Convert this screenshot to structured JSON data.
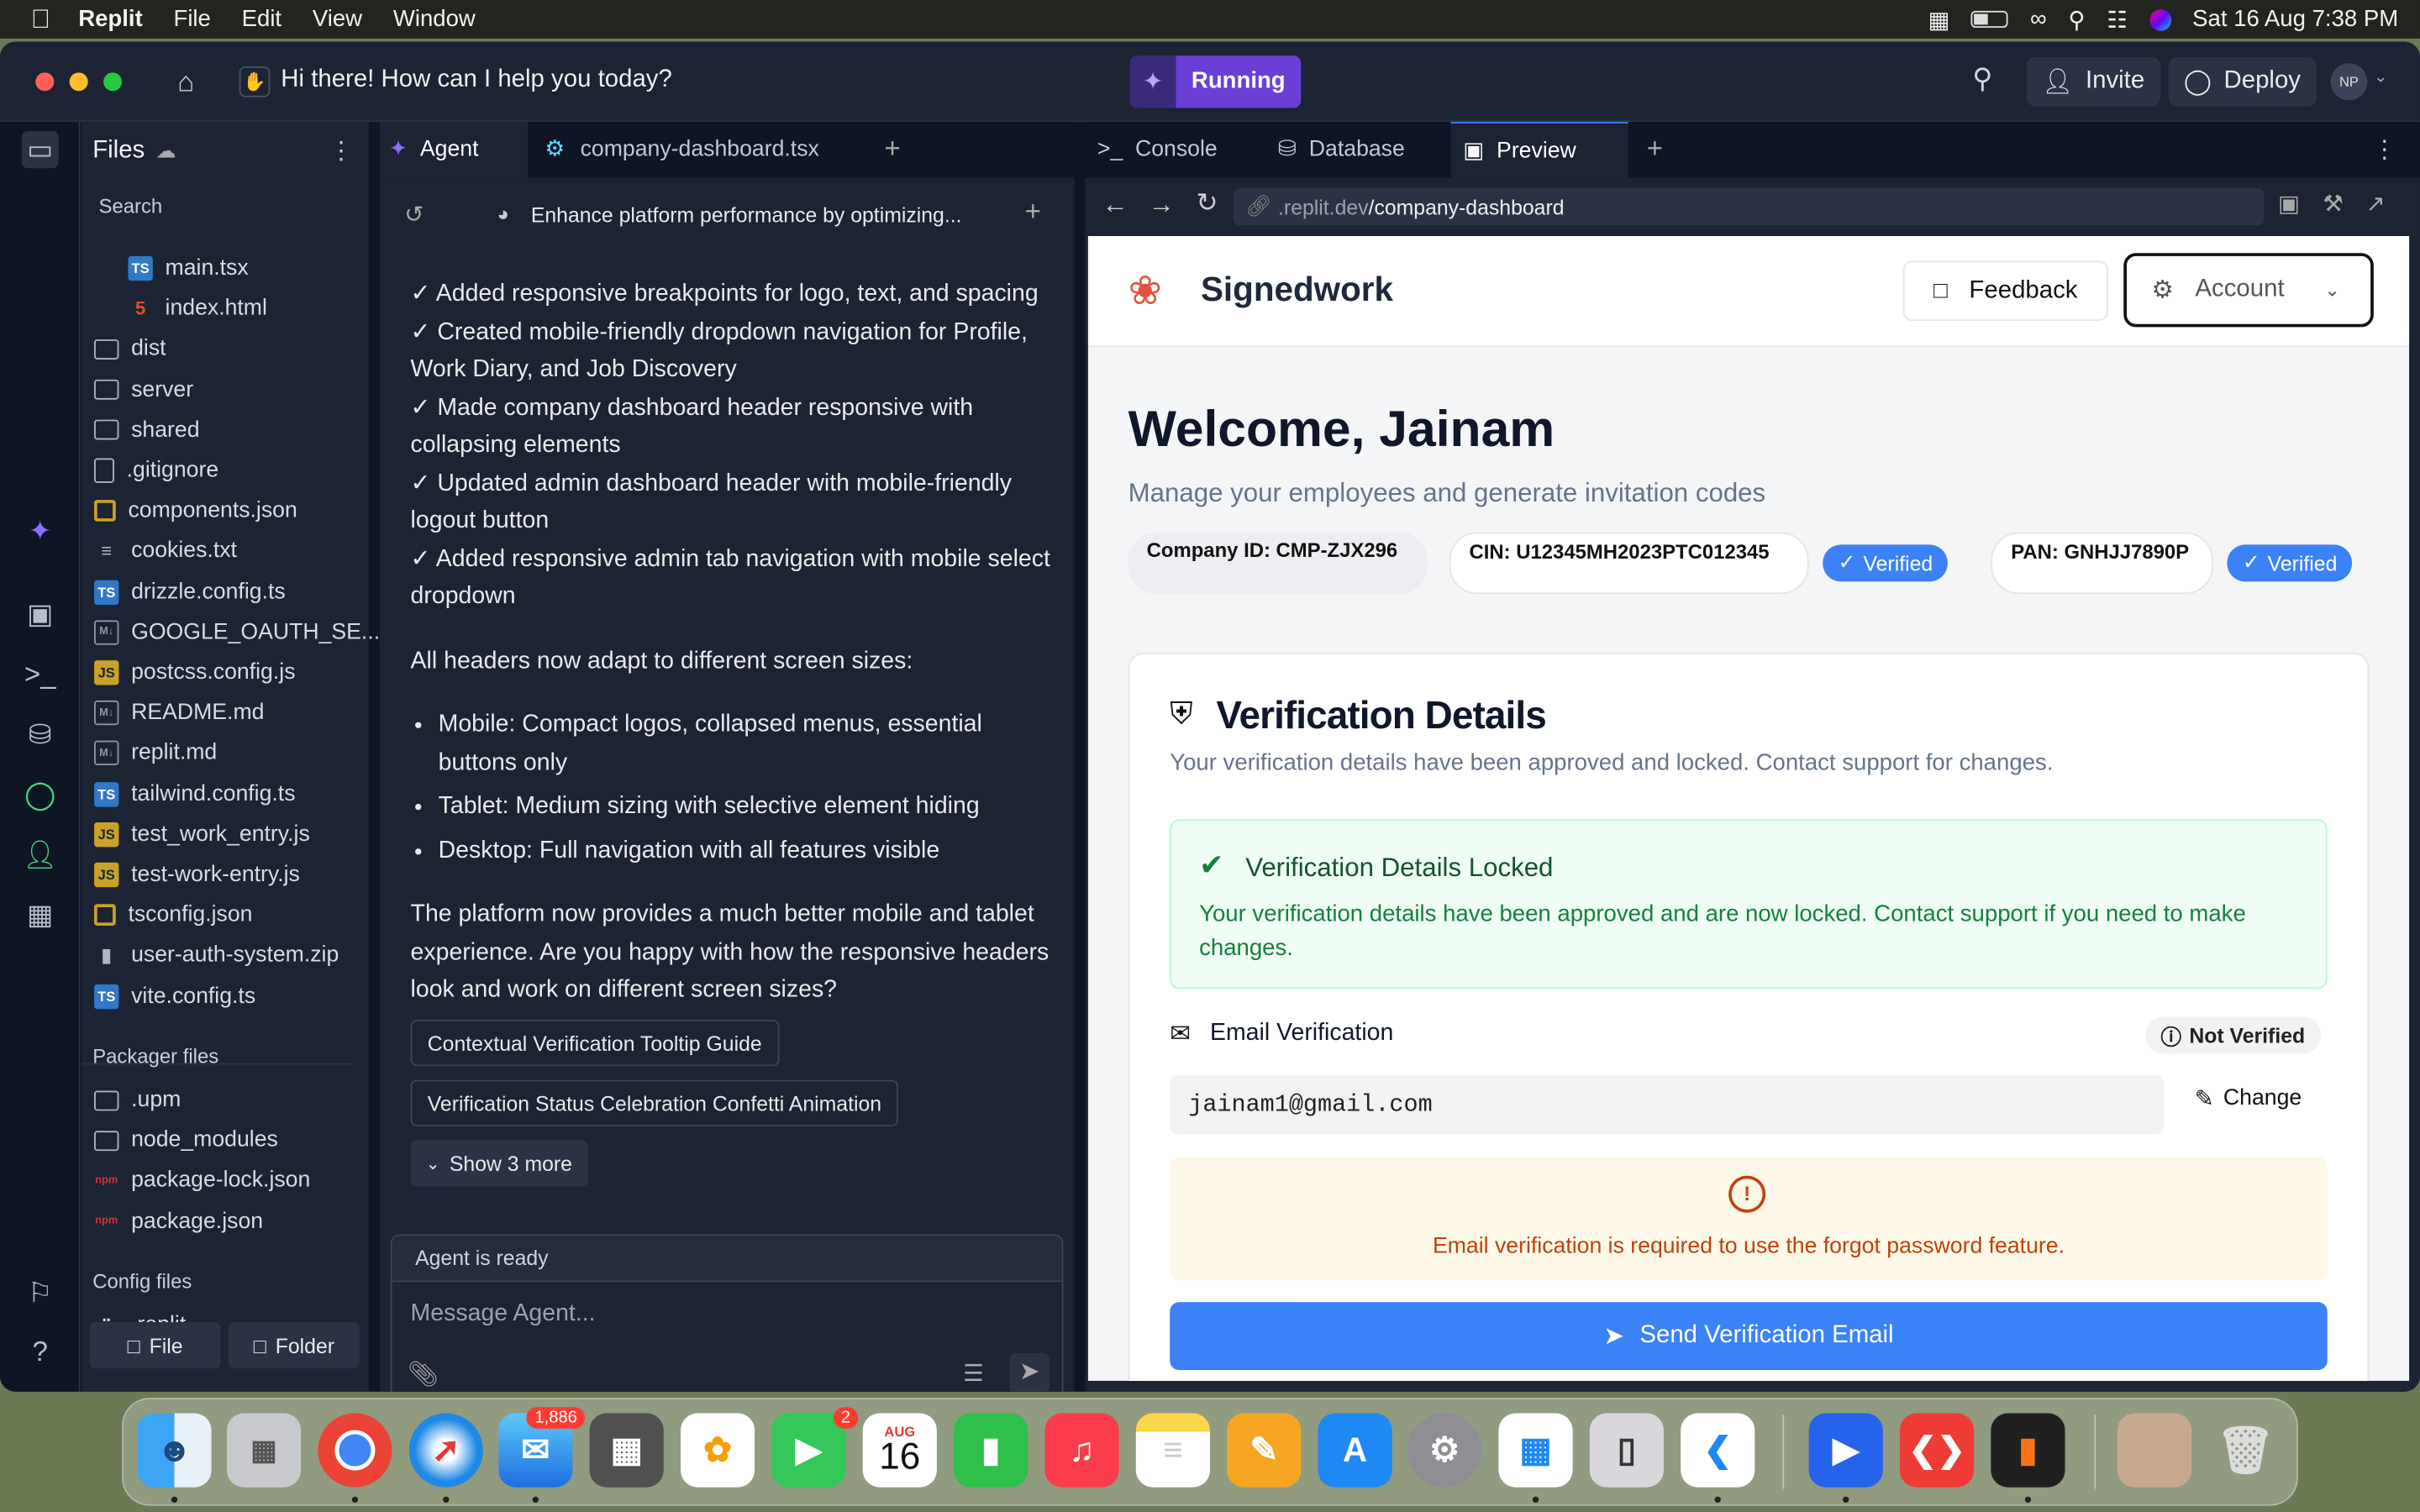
{
  "menubar": {
    "app": "Replit",
    "menus": [
      "File",
      "Edit",
      "View",
      "Window"
    ],
    "datetime": "Sat 16 Aug  7:38 PM"
  },
  "titlebar": {
    "prompt": "Hi there! How can I help you today?",
    "run_status": "Running",
    "invite": "Invite",
    "deploy": "Deploy",
    "avatar": "NP"
  },
  "files": {
    "title": "Files",
    "search_placeholder": "Search",
    "items": [
      {
        "name": "main.tsx",
        "type": "ts"
      },
      {
        "name": "index.html",
        "type": "html"
      },
      {
        "name": "dist",
        "type": "folder"
      },
      {
        "name": "server",
        "type": "folder"
      },
      {
        "name": "shared",
        "type": "folder"
      },
      {
        "name": ".gitignore",
        "type": "doc"
      },
      {
        "name": "components.json",
        "type": "json"
      },
      {
        "name": "cookies.txt",
        "type": "txt"
      },
      {
        "name": "drizzle.config.ts",
        "type": "ts"
      },
      {
        "name": "GOOGLE_OAUTH_SE...",
        "type": "md"
      },
      {
        "name": "postcss.config.js",
        "type": "js"
      },
      {
        "name": "README.md",
        "type": "md"
      },
      {
        "name": "replit.md",
        "type": "md"
      },
      {
        "name": "tailwind.config.ts",
        "type": "ts"
      },
      {
        "name": "test_work_entry.js",
        "type": "js"
      },
      {
        "name": "test-work-entry.js",
        "type": "js"
      },
      {
        "name": "tsconfig.json",
        "type": "json"
      },
      {
        "name": "user-auth-system.zip",
        "type": "zip"
      },
      {
        "name": "vite.config.ts",
        "type": "ts"
      }
    ],
    "packager_title": "Packager files",
    "packager_items": [
      {
        "name": ".upm",
        "type": "folder"
      },
      {
        "name": "node_modules",
        "type": "folder"
      },
      {
        "name": "package-lock.json",
        "type": "npm"
      },
      {
        "name": "package.json",
        "type": "npm"
      }
    ],
    "config_title": "Config files",
    "config_items": [
      {
        "name": ".replit",
        "type": "replit"
      }
    ],
    "new_file": "File",
    "new_folder": "Folder"
  },
  "agent": {
    "tab": "Agent",
    "file_tab": "company-dashboard.tsx",
    "thread_title": "Enhance platform performance by optimizing...",
    "checks": [
      "✓ Added responsive breakpoints for logo, text, and spacing",
      "✓ Created mobile-friendly dropdown navigation for Profile, Work Diary, and Job Discovery",
      "✓ Made company dashboard header responsive with collapsing elements",
      "✓ Updated admin dashboard header with mobile-friendly logout button",
      "✓ Added responsive admin tab navigation with mobile select dropdown"
    ],
    "intro": "All headers now adapt to different screen sizes:",
    "bullets": [
      "Mobile: Compact logos, collapsed menus, essential buttons only",
      "Tablet: Medium sizing with selective element hiding",
      "Desktop: Full navigation with all features visible"
    ],
    "closing": "The platform now provides a much better mobile and tablet experience. Are you happy with how the responsive headers look and work on different screen sizes?",
    "suggestions": [
      "Contextual Verification Tooltip Guide",
      "Verification Status Celebration Confetti Animation"
    ],
    "show_more": "Show 3 more",
    "status": "Agent is ready",
    "input_placeholder": "Message Agent..."
  },
  "right": {
    "tabs": [
      "Console",
      "Database",
      "Preview"
    ],
    "url_prefix": ".replit.dev",
    "url_path": "/company-dashboard"
  },
  "app": {
    "brand": "Signedwork",
    "feedback": "Feedback",
    "account": "Account",
    "welcome": "Welcome, Jainam",
    "subtitle": "Manage your employees and generate invitation codes",
    "company_id": "Company ID: CMP-ZJX296",
    "cin": "CIN: U12345MH2023PTC012345",
    "pan": "PAN: GNHJJ7890P",
    "verified": "Verified",
    "card_title": "Verification Details",
    "card_sub": "Your verification details have been approved and locked. Contact support for changes.",
    "locked_title": "Verification Details Locked",
    "locked_text": "Your verification details have been approved and are now locked. Contact support if you need to make changes.",
    "email_label": "Email Verification",
    "not_verified": "Not Verified",
    "email": "jainam1@gmail.com",
    "change": "Change",
    "warning": "Email verification is required to use the forgot password feature.",
    "send": "Send Verification Email"
  },
  "dock": {
    "mail_badge": "1,886",
    "facetime_badge": "2",
    "cal_month": "AUG",
    "cal_day": "16"
  },
  "colors": {
    "accent": "#3b82f6",
    "replit_purple": "#6b3fd6",
    "success": "#16a34a",
    "warning": "#c2410c"
  }
}
